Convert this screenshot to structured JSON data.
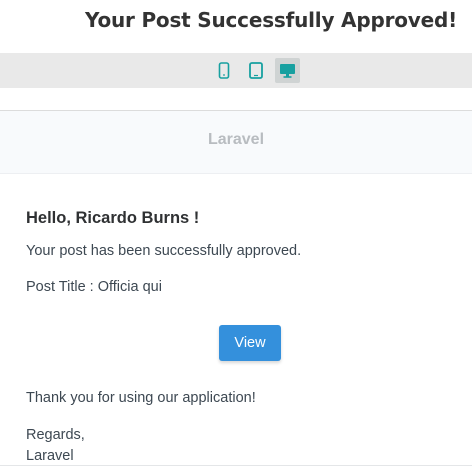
{
  "page": {
    "title": "Your Post Successfully Approved!"
  },
  "device_toolbar": {
    "buttons": [
      {
        "icon": "mobile-icon",
        "active": false
      },
      {
        "icon": "tablet-icon",
        "active": false
      },
      {
        "icon": "desktop-icon",
        "active": true
      }
    ],
    "icon_color": "#17a0a0"
  },
  "email": {
    "brand": "Laravel",
    "greeting": "Hello, Ricardo Burns !",
    "message": "Your post has been successfully approved.",
    "post_title_line": "Post Title : Officia qui",
    "action_label": "View",
    "thanks": "Thank you for using our application!",
    "regards": "Regards,",
    "signature": "Laravel"
  },
  "colors": {
    "accent": "#3490dc",
    "header_bg": "#f8fafc",
    "toolbar_bg": "#e9e9e9"
  }
}
